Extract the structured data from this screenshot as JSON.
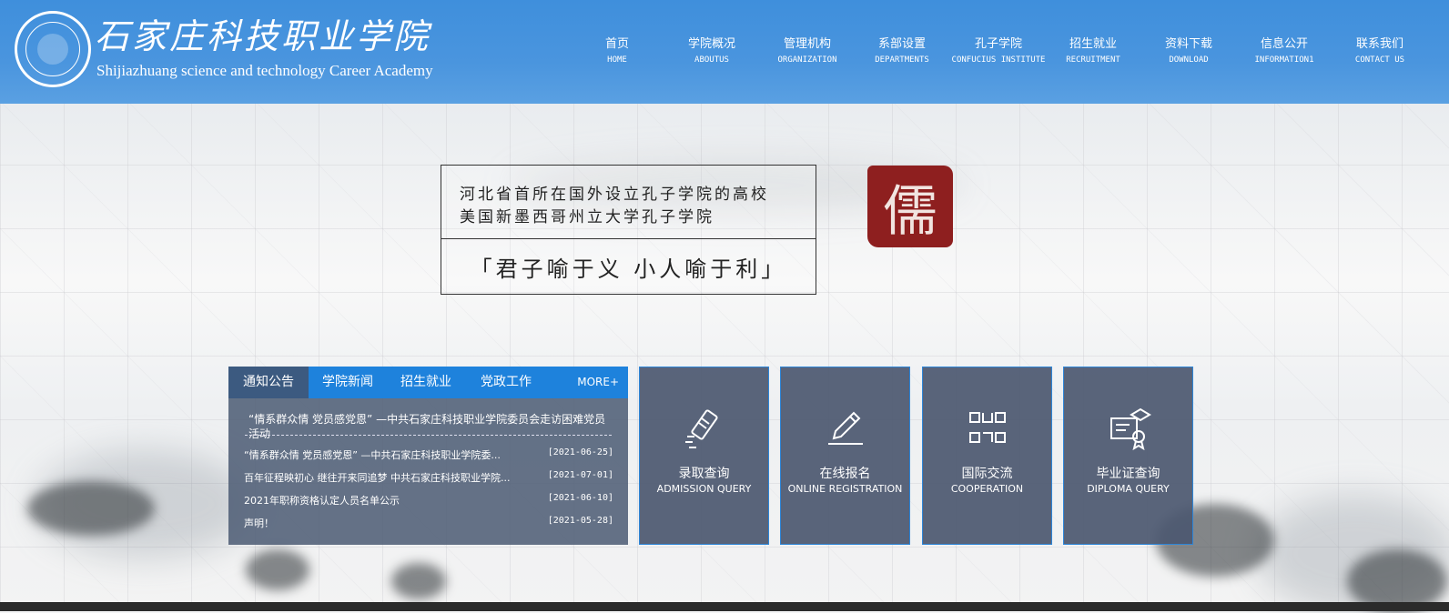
{
  "header": {
    "logo_cn": "石家庄科技职业学院",
    "logo_en": "Shijiazhuang science and technology Career Academy",
    "nav": [
      {
        "cn": "首页",
        "en": "HOME"
      },
      {
        "cn": "学院概况",
        "en": "ABOUTUS"
      },
      {
        "cn": "管理机构",
        "en": "ORGANIZATION"
      },
      {
        "cn": "系部设置",
        "en": "DEPARTMENTS"
      },
      {
        "cn": "孔子学院",
        "en": "CONFUCIUS INSTITUTE"
      },
      {
        "cn": "招生就业",
        "en": "RECRUITMENT"
      },
      {
        "cn": "资料下载",
        "en": "DOWNLOAD"
      },
      {
        "cn": "信息公开",
        "en": "INFORMATION1"
      },
      {
        "cn": "联系我们",
        "en": "CONTACT US"
      }
    ]
  },
  "slogan": {
    "line1": "河北省首所在国外设立孔子学院的高校",
    "line2": "美国新墨西哥州立大学孔子学院",
    "motto": "「君子喻于义 小人喻于利」",
    "seal_char": "儒"
  },
  "news": {
    "tabs": [
      "通知公告",
      "学院新闻",
      "招生就业",
      "党政工作"
    ],
    "more": "MORE+",
    "headline": "“情系群众情 党员感党恩” —中共石家庄科技职业学院委员会走访困难党员活动",
    "items": [
      {
        "title": "“情系群众情 党员感党恩” —中共石家庄科技职业学院委...",
        "date": "[2021-06-25]"
      },
      {
        "title": "百年征程映初心 继往开来同追梦 中共石家庄科技职业学院...",
        "date": "[2021-07-01]"
      },
      {
        "title": "2021年职称资格认定人员名单公示",
        "date": "[2021-06-10]"
      },
      {
        "title": "声明！",
        "date": "[2021-05-28]"
      }
    ]
  },
  "quick_links": [
    {
      "cn": "录取查询",
      "en": "ADMISSION QUERY",
      "icon": "admission-card-icon"
    },
    {
      "cn": "在线报名",
      "en": "ONLINE REGISTRATION",
      "icon": "pencil-icon"
    },
    {
      "cn": "国际交流",
      "en": "COOPERATION",
      "icon": "exchange-icon"
    },
    {
      "cn": "毕业证查询",
      "en": "DIPLOMA QUERY",
      "icon": "diploma-icon"
    }
  ],
  "colors": {
    "header_blue": "#4a95de",
    "tab_bar_blue": "#1e82dc",
    "panel_slate": "#505e76",
    "seal_red": "#8e1f1f"
  }
}
